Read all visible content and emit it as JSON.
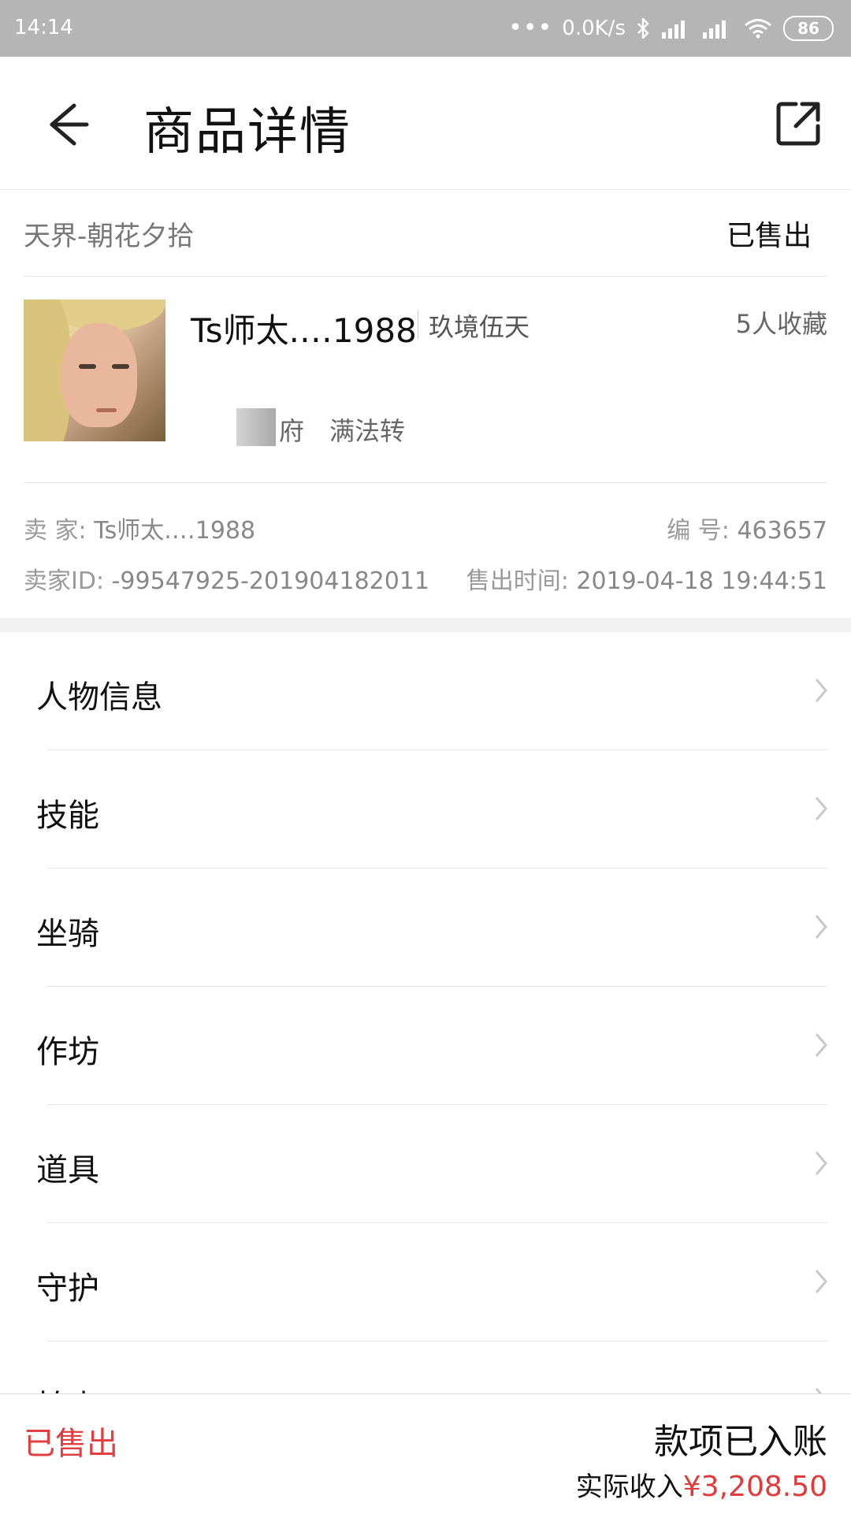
{
  "status_bar": {
    "time": "14:14",
    "dots": "•••",
    "net_speed": "0.0K/s",
    "battery": "86"
  },
  "header": {
    "title": "商品详情"
  },
  "server": {
    "name": "天界-朝花夕拾",
    "status": "已售出"
  },
  "character": {
    "name": "Ts师太.…1988",
    "level": "玖境伍天",
    "favorites": "5人收藏",
    "school": "府",
    "rebirth": "满法转"
  },
  "info": {
    "seller_label": "卖 家:",
    "seller_value": "Ts师太.…1988",
    "number_label": "编 号:",
    "number_value": "463657",
    "seller_id_label": "卖家ID:",
    "seller_id_value": "-99547925-201904182011",
    "sold_time_label": "售出时间:",
    "sold_time_value": "2019-04-18 19:44:51"
  },
  "menu": [
    {
      "label": "人物信息"
    },
    {
      "label": "技能"
    },
    {
      "label": "坐骑"
    },
    {
      "label": "作坊"
    },
    {
      "label": "道具"
    },
    {
      "label": "守护"
    },
    {
      "label": "拍卖"
    }
  ],
  "bottom_bar": {
    "status": "已售出",
    "payment_status": "款项已入账",
    "income_label": "实际收入",
    "income_amount": "¥3,208.50"
  },
  "colors": {
    "status_bar_bg": "#b5b5b5",
    "accent_red": "#e24040"
  }
}
